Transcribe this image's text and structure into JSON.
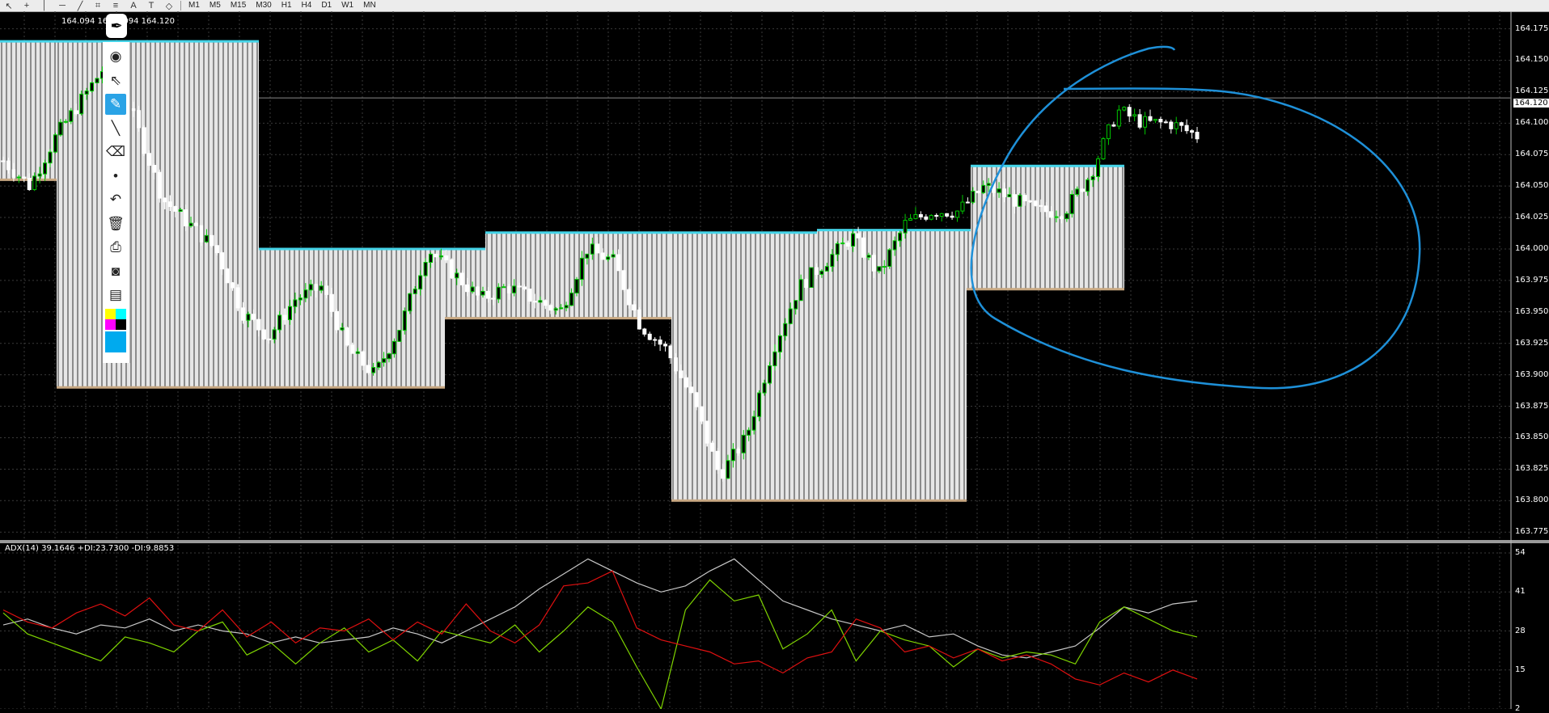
{
  "toolbar": {
    "tools": [
      "cursor-icon",
      "crosshair-icon",
      "vertical-line-icon",
      "horizontal-line-icon",
      "trendline-icon",
      "fibonacci-icon",
      "channel-icon",
      "text-icon",
      "label-icon",
      "shapes-icon"
    ],
    "timeframes": [
      "M1",
      "M5",
      "M15",
      "M30",
      "H1",
      "H4",
      "D1",
      "W1",
      "MN"
    ]
  },
  "quote_text": "164.094 164 4.094 164.120",
  "current_price": "164.120",
  "pen_toolbar": {
    "items": [
      "eye-icon",
      "select-arrow-icon",
      "highlighter-icon",
      "line-pen-icon",
      "eraser-icon",
      "dot-icon",
      "undo-icon",
      "trash-icon",
      "stamp-icon",
      "camera-icon",
      "clipboard-icon",
      "color-palette-icon",
      "blue-swatch-icon"
    ],
    "palette": [
      "#ffff00",
      "#00ffff",
      "#ff00ff",
      "#000000"
    ],
    "selected_color": "#00aaee"
  },
  "adx_label": "ADX(14) 39.1646 +DI:23.7300 -DI:9.8853",
  "colors": {
    "background": "#000000",
    "grid": "#3a3a3a",
    "bull_candle": "#00c800",
    "bear_candle": "#ffffff",
    "box_fill": "#e6e6e6",
    "box_top": "#44d4e8",
    "box_bottom": "#c8a882",
    "adx": "#c8c8c8",
    "plus_di": "#7fd400",
    "minus_di": "#e01010",
    "annotation": "#1e90d8"
  },
  "chart_data": [
    {
      "type": "candlestick",
      "y_ticks": [
        "164.175",
        "164.150",
        "164.125",
        "164.100",
        "164.075",
        "164.050",
        "164.025",
        "164.000",
        "163.975",
        "163.950",
        "163.925",
        "163.900",
        "163.875",
        "163.850",
        "163.825",
        "163.800",
        "163.775"
      ],
      "ylim": [
        163.77,
        164.185
      ],
      "grid": true,
      "close_series": [
        164.07,
        164.05,
        164.09,
        164.12,
        164.15,
        164.1,
        164.04,
        164.02,
        164.0,
        163.95,
        163.93,
        163.96,
        163.97,
        163.92,
        163.9,
        163.94,
        164.0,
        163.98,
        163.96,
        163.97,
        163.96,
        163.95,
        164.0,
        163.99,
        163.94,
        163.92,
        163.88,
        163.82,
        163.85,
        163.92,
        163.97,
        163.99,
        164.01,
        163.98,
        164.02,
        164.03,
        164.03,
        164.05,
        164.04,
        164.03,
        164.03,
        164.06,
        164.11,
        164.1,
        164.1,
        164.09
      ],
      "range_boxes": [
        {
          "top": 164.165,
          "bottom": 164.055
        },
        {
          "top": 164.165,
          "bottom": 163.89
        },
        {
          "top": 164.0,
          "bottom": 163.89
        },
        {
          "top": 164.0,
          "bottom": 163.945
        },
        {
          "top": 164.013,
          "bottom": 163.945
        },
        {
          "top": 164.013,
          "bottom": 163.8
        },
        {
          "top": 164.015,
          "bottom": 163.8
        },
        {
          "top": 164.015,
          "bottom": 163.968
        },
        {
          "top": 164.066,
          "bottom": 163.968
        },
        {
          "top": 164.066,
          "bottom": 164.019
        }
      ]
    },
    {
      "type": "line",
      "y_ticks": [
        "54",
        "41",
        "28",
        "15",
        "2"
      ],
      "ylim": [
        2,
        54
      ],
      "grid": true,
      "series": [
        {
          "values": [
            30,
            32,
            29,
            27,
            30,
            29,
            32,
            28,
            30,
            28,
            27,
            24,
            26,
            24,
            25,
            26,
            29,
            27,
            24,
            28,
            32,
            36,
            42,
            47,
            52,
            48,
            44,
            41,
            43,
            48,
            52,
            45,
            38,
            35,
            32,
            30,
            28,
            30,
            26,
            27,
            23,
            20,
            19,
            21,
            23,
            29,
            36,
            34,
            37,
            38
          ]
        },
        {
          "values": [
            34,
            27,
            24,
            21,
            18,
            26,
            24,
            21,
            28,
            31,
            20,
            24,
            17,
            24,
            29,
            21,
            25,
            18,
            28,
            26,
            24,
            30,
            21,
            28,
            36,
            31,
            16,
            2,
            35,
            45,
            38,
            40,
            22,
            27,
            35,
            18,
            28,
            25,
            23,
            16,
            22,
            19,
            21,
            20,
            17,
            31,
            36,
            32,
            28,
            26
          ]
        },
        {
          "values": [
            35,
            31,
            29,
            34,
            37,
            33,
            39,
            30,
            28,
            35,
            26,
            31,
            24,
            29,
            28,
            32,
            25,
            31,
            27,
            37,
            28,
            24,
            30,
            43,
            44,
            48,
            29,
            25,
            23,
            21,
            17,
            18,
            14,
            19,
            21,
            32,
            29,
            21,
            23,
            19,
            22,
            18,
            20,
            17,
            12,
            10,
            14,
            11,
            15,
            12
          ]
        }
      ]
    }
  ]
}
